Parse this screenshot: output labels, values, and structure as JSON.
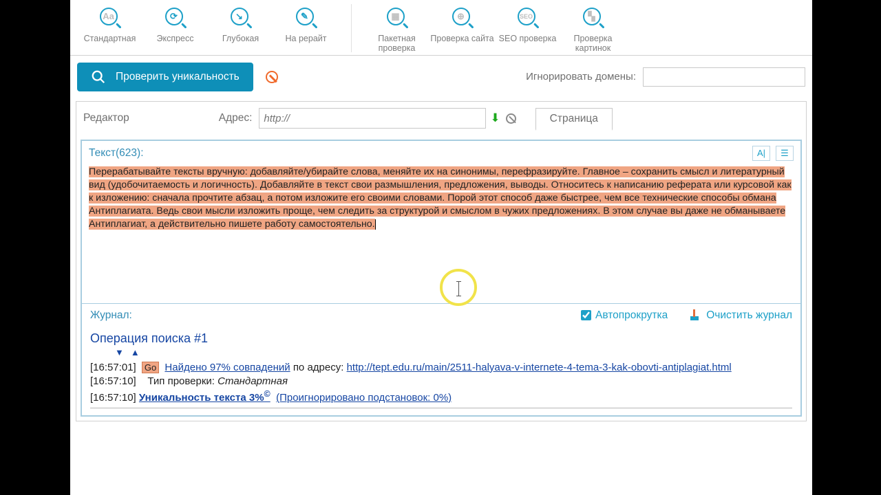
{
  "toolbar": {
    "group1": [
      {
        "label": "Стандартная",
        "inner": "Aа"
      },
      {
        "label": "Экспресс",
        "inner": "⟳"
      },
      {
        "label": "Глубокая",
        "inner": "↘"
      },
      {
        "label": "На рерайт",
        "inner": "✎"
      }
    ],
    "group2": [
      {
        "label": "Пакетная проверка",
        "inner": "▦"
      },
      {
        "label": "Проверка сайта",
        "inner": "⊕"
      },
      {
        "label": "SEO проверка",
        "inner": "SEO"
      },
      {
        "label": "Проверка картинок",
        "inner": "▚"
      }
    ]
  },
  "action": {
    "check_label": "Проверить уникальность",
    "ignore_label": "Игнорировать домены:",
    "ignore_value": ""
  },
  "panel": {
    "editor_label": "Редактор",
    "addr_label": "Адрес:",
    "addr_placeholder": "http://",
    "page_tab": "Страница"
  },
  "textarea": {
    "counter_label": "Текст(623):",
    "content": "Перерабатывайте тексты вручную: добавляйте/убирайте слова, меняйте их на синонимы, перефразируйте. Главное – сохранить смысл и литературный вид (удобочитаемость и логичность).\nДобавляйте в текст свои размышления, предложения, выводы. Относитесь к написанию реферата или курсовой как к изложению: сначала прочтите абзац, а потом изложите его своими словами. Порой этот способ даже быстрее, чем все технические способы обмана Антиплагиата. Ведь свои мысли изложить проще, чем следить за структурой и смыслом в чужих предложениях. В этом случае вы даже не обманываете Антиплагиат, а действительно пишете работу самостоятельно."
  },
  "log": {
    "head": "Журнал:",
    "autoscroll": "Автопрокрутка",
    "clear": "Очистить журнал",
    "op_title": "Операция поиска #1",
    "line1": {
      "ts": "[16:57:01]",
      "go": "Go",
      "found": "Найдено 97% совпадений",
      "by": "по адресу:",
      "url": "http://tept.edu.ru/main/2511-halyava-v-internete-4-tema-3-kak-obovti-antiplagiat.html"
    },
    "line2": {
      "ts": "[16:57:10]",
      "label": "Тип проверки:",
      "val": "Стандартная"
    },
    "line3": {
      "ts": "[16:57:10]",
      "uni": "Уникальность текста 3%",
      "sup": "©",
      "ign": "(Проигнорировано подстановок: 0%)"
    }
  }
}
